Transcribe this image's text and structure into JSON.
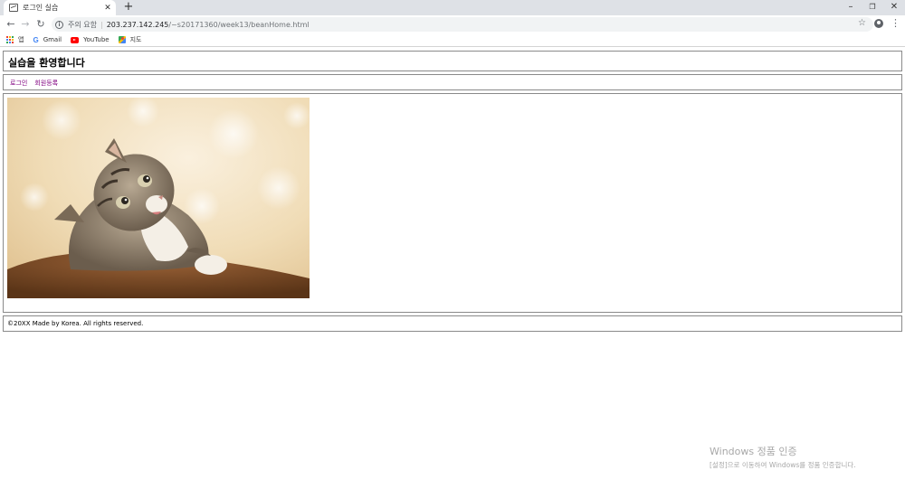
{
  "browser": {
    "tab_title": "로그인 실습",
    "security_text": "주의 요함",
    "url_host": "203.237.142.245",
    "url_path": "/~s20171360/week13/beanHome.html",
    "bookmarks": [
      {
        "label": "앱",
        "icon": "apps-grid-icon"
      },
      {
        "label": "Gmail",
        "icon": "google-icon"
      },
      {
        "label": "YouTube",
        "icon": "youtube-icon"
      },
      {
        "label": "지도",
        "icon": "maps-icon"
      }
    ]
  },
  "page": {
    "title": "실습을 환영합니다",
    "nav": [
      "로그인",
      "회원등록"
    ],
    "footer": "©20XX Made by Korea. All rights reserved."
  },
  "watermark": {
    "title": "Windows 정품 인증",
    "subtitle": "[설정]으로 이동하여 Windows를 정품 인증합니다."
  },
  "colors": {
    "link": "#800080",
    "border": "#8a8a8a",
    "tabstrip": "#dee1e6"
  }
}
